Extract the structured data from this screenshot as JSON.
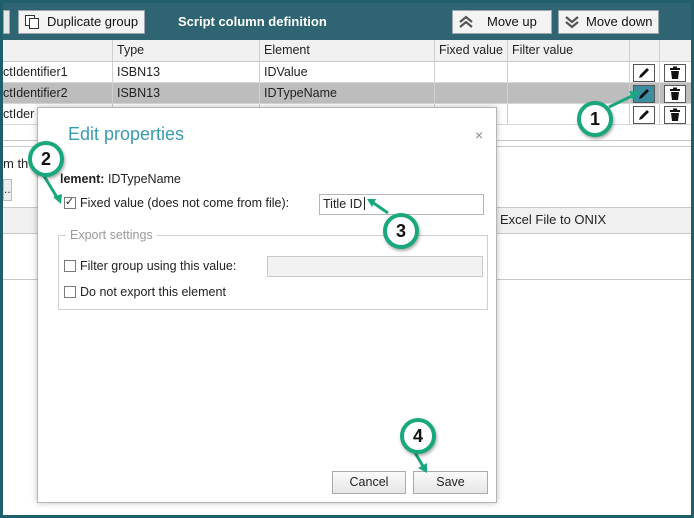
{
  "toolbar": {
    "duplicate_label": "Duplicate group",
    "title": "Script column definition",
    "move_up_label": "Move up",
    "move_down_label": "Move down"
  },
  "grid": {
    "columns": [
      "",
      "Type",
      "Element",
      "Fixed value",
      "Filter value",
      "",
      ""
    ],
    "rows": [
      {
        "name": "ctIdentifier1",
        "type": "ISBN13",
        "element": "IDValue",
        "fixed": "",
        "filter": ""
      },
      {
        "name": "ctIdentifier2",
        "type": "ISBN13",
        "element": "IDTypeName",
        "fixed": "",
        "filter": ""
      },
      {
        "name": "ctIder",
        "type": "",
        "element": "",
        "fixed": "",
        "filter": ""
      }
    ]
  },
  "background": {
    "partial_text_1": "m th",
    "partial_text_2": "..",
    "tab_label": "Excel File to ONIX"
  },
  "dialog": {
    "title": "Edit properties",
    "close_glyph": "×",
    "element_label": "lement:",
    "element_value": "IDTypeName",
    "fixed_value_label": "Fixed value (does not come from file):",
    "fixed_value_checked": true,
    "fixed_value_input": "Title ID",
    "export_settings_legend": "Export settings",
    "filter_group_label": "Filter group using this value:",
    "filter_group_checked": false,
    "filter_group_input": "",
    "do_not_export_label": "Do not export this element",
    "do_not_export_checked": false,
    "cancel_label": "Cancel",
    "save_label": "Save"
  },
  "callouts": [
    "1",
    "2",
    "3",
    "4"
  ],
  "colors": {
    "toolbar_bg": "#2f6473",
    "dialog_title": "#3a9bb0",
    "callout_ring": "#19a77e",
    "selected_row": "#bdbdbd",
    "active_edit_button": "#3b8da0"
  }
}
